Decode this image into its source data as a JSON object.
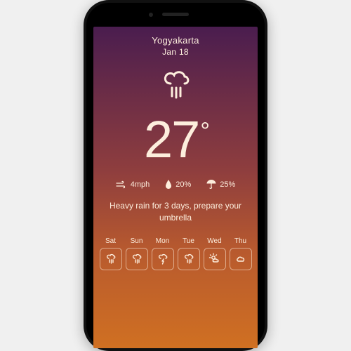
{
  "header": {
    "location": "Yogyakarta",
    "date": "Jan 18"
  },
  "current": {
    "temperature": "27",
    "icon": "heavy-rain"
  },
  "stats": {
    "wind": "4mph",
    "humidity": "20%",
    "precip": "25%"
  },
  "description": "Heavy rain for 3 days, prepare your umbrella",
  "forecast": [
    {
      "day": "Sat",
      "icon": "heavy-rain"
    },
    {
      "day": "Sun",
      "icon": "heavy-rain"
    },
    {
      "day": "Mon",
      "icon": "thunder"
    },
    {
      "day": "Tue",
      "icon": "heavy-rain"
    },
    {
      "day": "Wed",
      "icon": "partly-sunny"
    },
    {
      "day": "Thu",
      "icon": "cloud"
    }
  ],
  "colors": {
    "text": "#fdeedd",
    "gradient_top": "#4a1d4f",
    "gradient_bottom": "#d07022"
  }
}
